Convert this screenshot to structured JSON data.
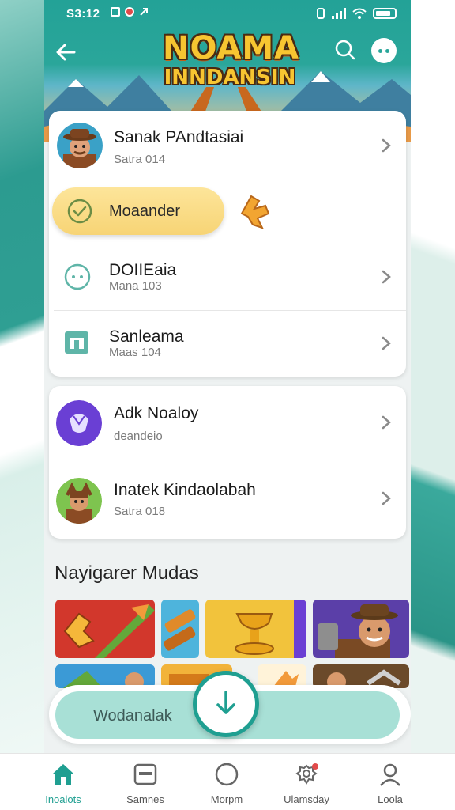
{
  "status_bar": {
    "time": "S3:12"
  },
  "header": {
    "logo_line1": "NOAMA",
    "logo_line2": "INNDANSIN"
  },
  "list_card_1": {
    "profile": {
      "title": "Sanak PAndtasiai",
      "subtitle": "Satra 014"
    },
    "highlight": {
      "label": "Moaander"
    },
    "items": [
      {
        "title": "DOIIEaia",
        "subtitle": "Mana 103"
      },
      {
        "title": "Sanleama",
        "subtitle": "Maas 104"
      }
    ]
  },
  "list_card_2": {
    "items": [
      {
        "title": "Adk Noaloy",
        "subtitle": "deandeio"
      },
      {
        "title": "Inatek Kindaolabah",
        "subtitle": "Satra 018"
      }
    ]
  },
  "section": {
    "title": "Nayigarer Mudas"
  },
  "download_bar": {
    "label": "Wodanalak"
  },
  "bottom_nav": {
    "items": [
      {
        "label": "Inoalots",
        "icon": "home-icon",
        "active": true
      },
      {
        "label": "Samnes",
        "icon": "tv-icon",
        "active": false
      },
      {
        "label": "Morpm",
        "icon": "circle-icon",
        "active": false
      },
      {
        "label": "Ulamsday",
        "icon": "gear-badge-icon",
        "active": false
      },
      {
        "label": "Loola",
        "icon": "person-icon",
        "active": false
      }
    ]
  },
  "colors": {
    "accent": "#1f9f91",
    "highlight": "#f7d475",
    "header": "#23a297",
    "badge": "#e14a4a"
  }
}
